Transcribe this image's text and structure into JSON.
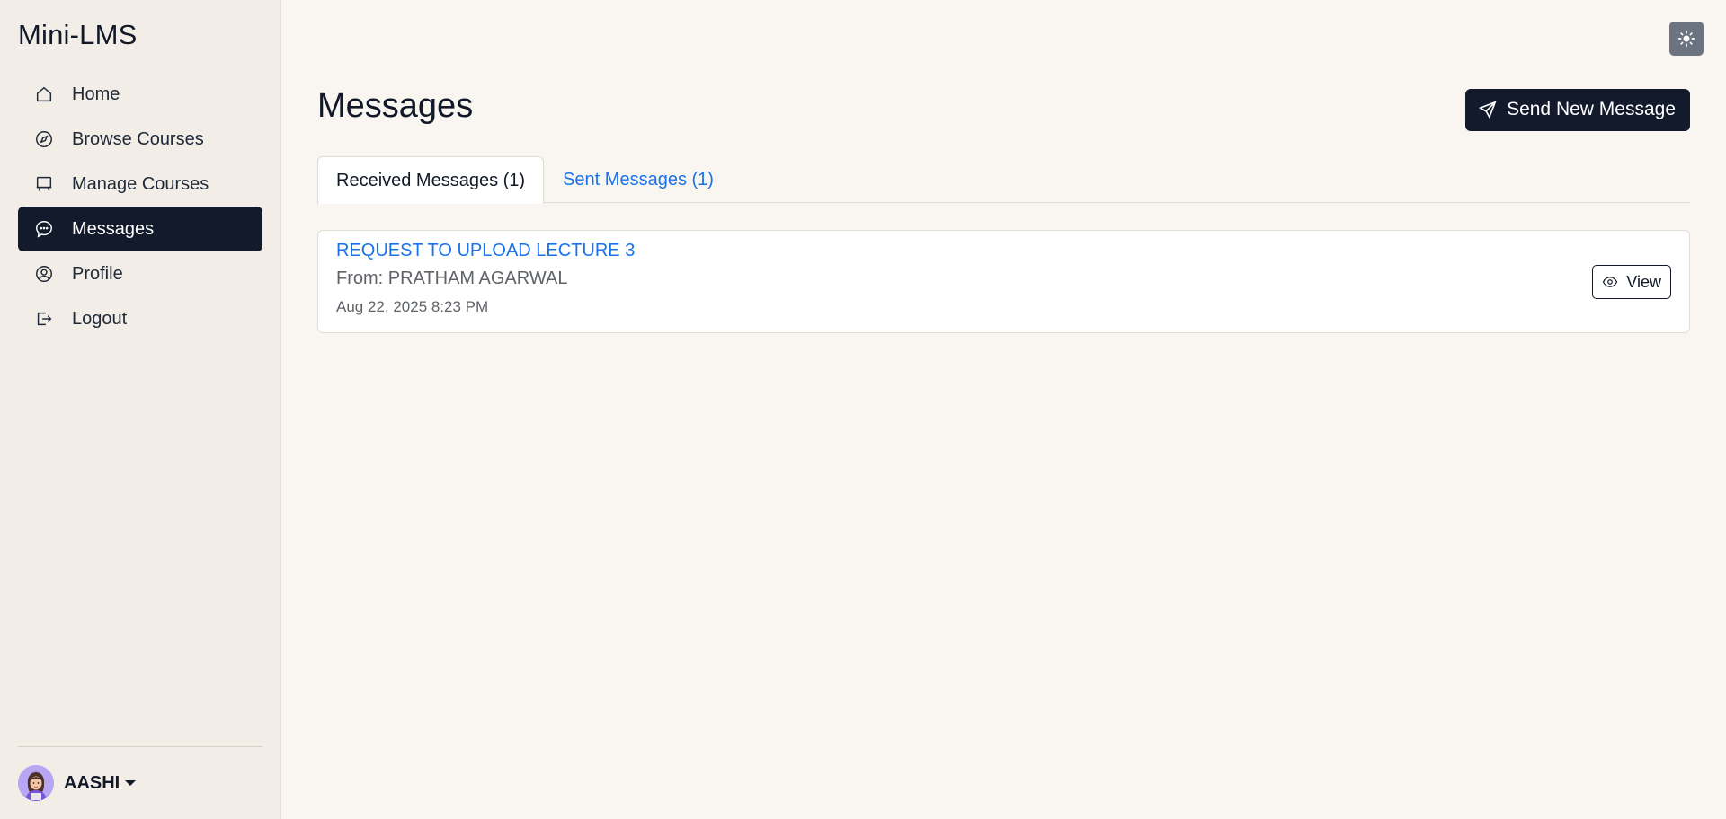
{
  "app": {
    "title": "Mini-LMS"
  },
  "sidebar": {
    "items": [
      {
        "label": "Home",
        "icon": "home-icon",
        "active": false
      },
      {
        "label": "Browse Courses",
        "icon": "compass-icon",
        "active": false
      },
      {
        "label": "Manage Courses",
        "icon": "easel-icon",
        "active": false
      },
      {
        "label": "Messages",
        "icon": "chat-icon",
        "active": true
      },
      {
        "label": "Profile",
        "icon": "user-circle-icon",
        "active": false
      },
      {
        "label": "Logout",
        "icon": "logout-icon",
        "active": false
      }
    ],
    "user": {
      "name": "AASHI"
    }
  },
  "main": {
    "title": "Messages",
    "send_button_label": "Send New Message",
    "tabs": [
      {
        "label": "Received Messages (1)",
        "active": true
      },
      {
        "label": "Sent Messages (1)",
        "active": false
      }
    ],
    "messages": [
      {
        "subject": "REQUEST TO UPLOAD LECTURE 3",
        "from": "From: PRATHAM AGARWAL",
        "date": "Aug 22, 2025 8:23 PM",
        "view_label": "View"
      }
    ]
  },
  "colors": {
    "accent": "#121a2b",
    "link": "#1a73e8",
    "sidebar_bg": "#f2ede7",
    "page_bg": "#f9f6f1"
  }
}
